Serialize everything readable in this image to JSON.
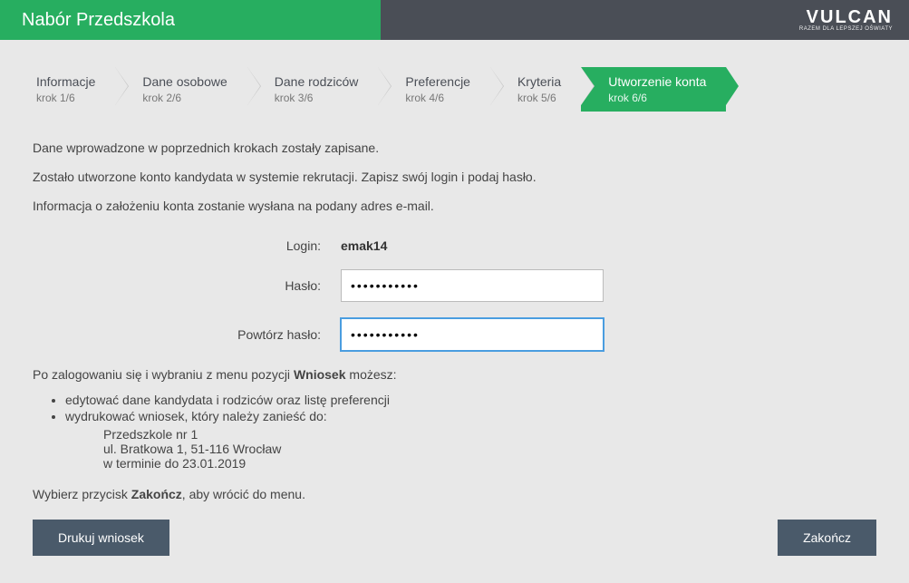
{
  "header": {
    "app_title": "Nabór Przedszkola",
    "logo": "VULCAN",
    "logo_sub": "RAZEM DLA LEPSZEJ OŚWIATY"
  },
  "steps": [
    {
      "title": "Informacje",
      "sub": "krok 1/6"
    },
    {
      "title": "Dane osobowe",
      "sub": "krok 2/6"
    },
    {
      "title": "Dane rodziców",
      "sub": "krok 3/6"
    },
    {
      "title": "Preferencje",
      "sub": "krok 4/6"
    },
    {
      "title": "Kryteria",
      "sub": "krok 5/6"
    },
    {
      "title": "Utworzenie konta",
      "sub": "krok 6/6"
    }
  ],
  "info": {
    "line1": "Dane wprowadzone w poprzednich krokach zostały zapisane.",
    "line2": "Zostało utworzone konto kandydata w systemie rekrutacji. Zapisz swój login i podaj hasło.",
    "line3": "Informacja o założeniu konta zostanie wysłana na podany adres e-mail."
  },
  "form": {
    "login_label": "Login:",
    "login_value": "emak14",
    "password_label": "Hasło:",
    "password_value": "•••••••••••",
    "password_repeat_label": "Powtórz hasło:",
    "password_repeat_value": "•••••••••••"
  },
  "post": {
    "intro_a": "Po zalogowaniu się i wybraniu z menu pozycji ",
    "intro_b": "Wniosek",
    "intro_c": " możesz:",
    "bullet1": "edytować dane kandydata i rodziców oraz listę preferencji",
    "bullet2": "wydrukować wniosek, który należy zanieść do:",
    "place": "Przedszkole nr 1",
    "address": "ul. Bratkowa 1, 51-116 Wrocław",
    "deadline": "w terminie do 23.01.2019",
    "footer_a": "Wybierz przycisk ",
    "footer_b": "Zakończ",
    "footer_c": ", aby wrócić do menu."
  },
  "buttons": {
    "print": "Drukuj wniosek",
    "finish": "Zakończ"
  }
}
